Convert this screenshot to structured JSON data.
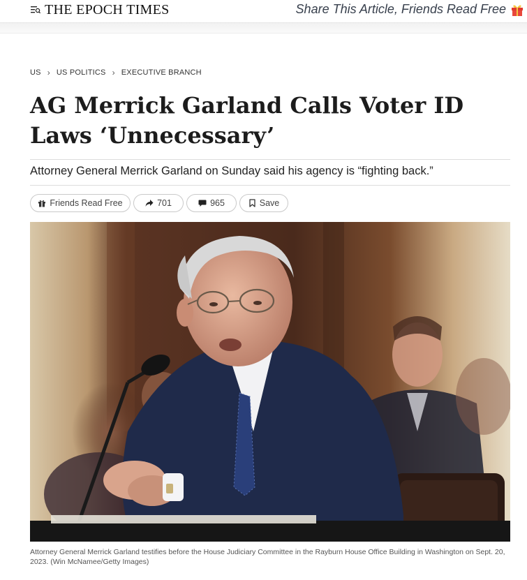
{
  "header": {
    "logo_text": "THE EPOCH TIMES",
    "share_promo": "Share This Article, Friends Read Free",
    "menu_icon": "menu-search-icon",
    "gift_icon": "gift-icon"
  },
  "breadcrumb": [
    "US",
    "US POLITICS",
    "EXECUTIVE BRANCH"
  ],
  "article": {
    "headline": "AG Merrick Garland Calls Voter ID Laws ‘Unnecessary’",
    "dek": "Attorney General Merrick Garland on Sunday said his agency is “fighting back.”"
  },
  "actions": {
    "friends_read_free": "Friends Read Free",
    "shares": "701",
    "comments": "965",
    "save": "Save"
  },
  "photo": {
    "caption": "Attorney General Merrick Garland testifies before the House Judiciary Committee in the Rayburn House Office Building in Washington on Sept. 20, 2023. (Win McNamee/Getty Images)"
  },
  "colors": {
    "brand_gift_red": "#e03a2f",
    "promo_text": "#38404d",
    "suit_navy": "#1f2a4a"
  }
}
